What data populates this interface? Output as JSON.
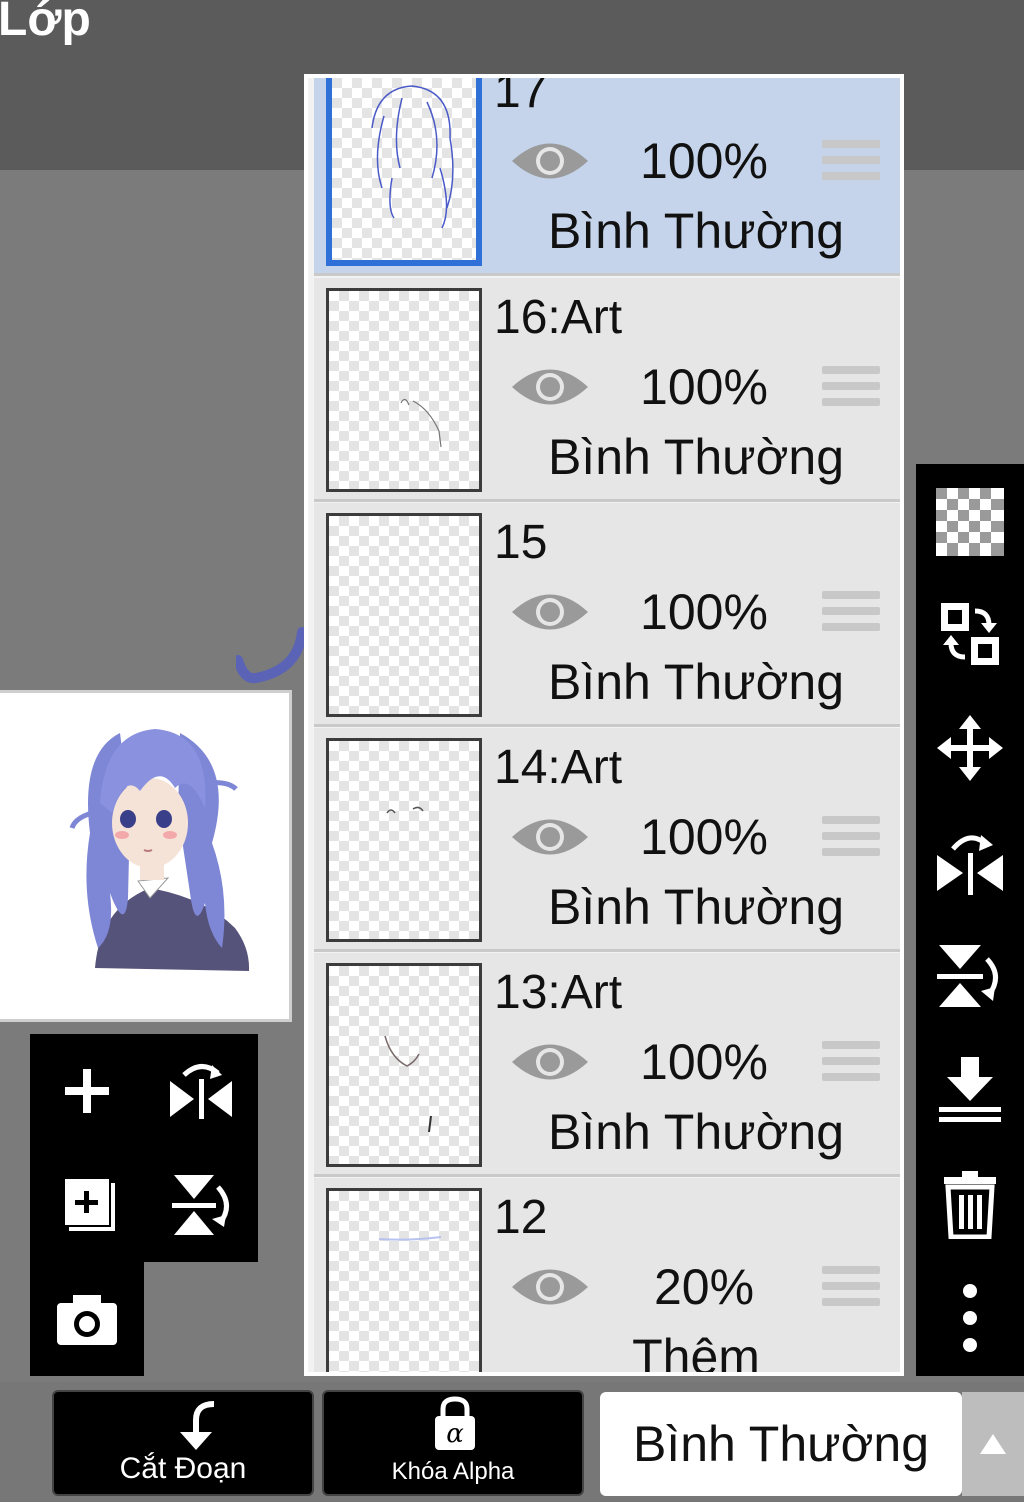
{
  "header": {
    "title": "Lớp"
  },
  "layers": [
    {
      "name": "17",
      "opacity": "100%",
      "blend": "Bình Thường",
      "selected": true
    },
    {
      "name": "16:Art",
      "opacity": "100%",
      "blend": "Bình Thường",
      "selected": false
    },
    {
      "name": "15",
      "opacity": "100%",
      "blend": "Bình Thường",
      "selected": false
    },
    {
      "name": "14:Art",
      "opacity": "100%",
      "blend": "Bình Thường",
      "selected": false
    },
    {
      "name": "13:Art",
      "opacity": "100%",
      "blend": "Bình Thường",
      "selected": false
    },
    {
      "name": "12",
      "opacity": "20%",
      "blend": "Thêm",
      "selected": false
    }
  ],
  "bottom_bar": {
    "clip_label": "Cắt Đoạn",
    "alpha_lock_label": "Khóa Alpha",
    "blend_mode_value": "Bình Thường"
  },
  "icons": {
    "left_tools": [
      "add-layer-icon",
      "flip-horizontal-icon",
      "add-layer-copy-icon",
      "flip-vertical-icon",
      "camera-icon"
    ],
    "right_tools": [
      "transparency-icon",
      "swap-layers-icon",
      "move-icon",
      "flip-horizontal-icon",
      "flip-vertical-icon",
      "merge-down-icon",
      "trash-icon",
      "more-icon"
    ]
  },
  "colors": {
    "selected_row": "#c5d4ea",
    "selected_border": "#2f6fd8",
    "hair": "#7e86d6"
  }
}
